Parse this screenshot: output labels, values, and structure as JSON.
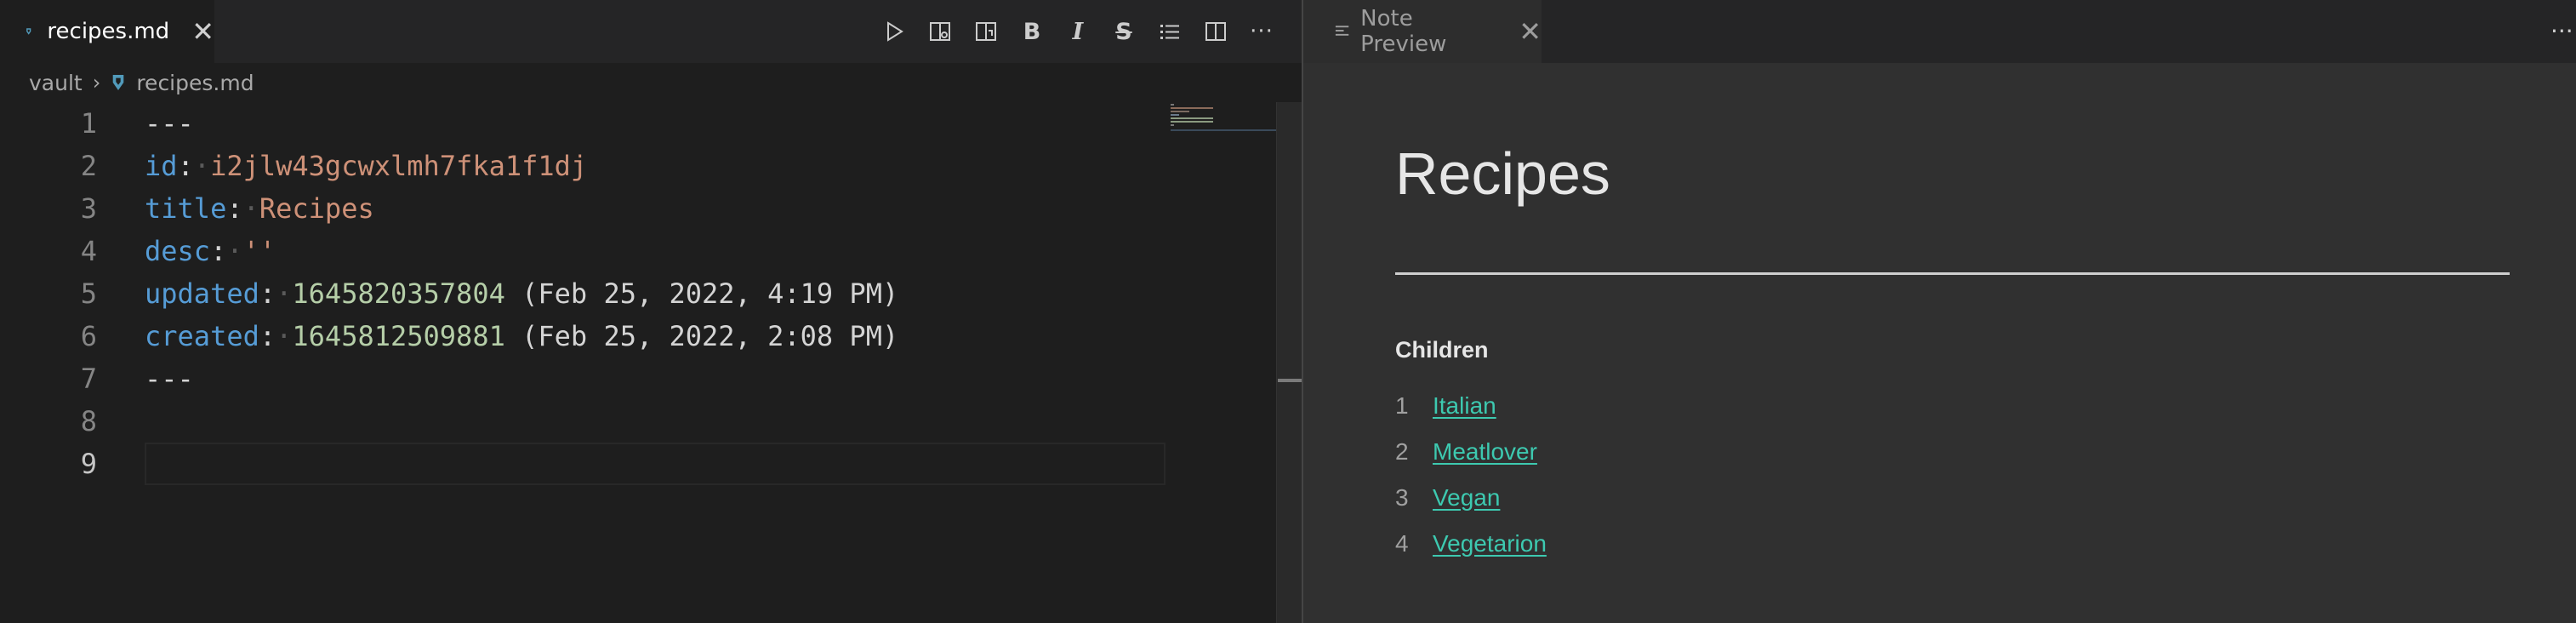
{
  "editor": {
    "tab": {
      "label": "recipes.md",
      "close": "✕"
    },
    "toolbar": {
      "buttons": [
        "run-icon",
        "open-preview-icon",
        "preview-side-icon",
        "bold-icon",
        "italic-icon",
        "strikethrough-icon",
        "list-icon",
        "split-editor-icon",
        "more-actions-icon"
      ],
      "bold_glyph": "B",
      "italic_glyph": "I",
      "strike_glyph": "S",
      "more_glyph": "···"
    },
    "breadcrumb": {
      "folder": "vault",
      "separator": "›",
      "file": "recipes.md"
    },
    "lines": [
      {
        "num": "1",
        "tokens": [
          {
            "t": "---",
            "c": "p"
          }
        ]
      },
      {
        "num": "2",
        "tokens": [
          {
            "t": "id",
            "c": "k"
          },
          {
            "t": ":",
            "c": "p"
          },
          {
            "t": "·",
            "c": "dot"
          },
          {
            "t": "i2jlw43gcwxlmh7fka1f1dj",
            "c": "s"
          }
        ]
      },
      {
        "num": "3",
        "tokens": [
          {
            "t": "title",
            "c": "k"
          },
          {
            "t": ":",
            "c": "p"
          },
          {
            "t": "·",
            "c": "dot"
          },
          {
            "t": "Recipes",
            "c": "s"
          }
        ]
      },
      {
        "num": "4",
        "tokens": [
          {
            "t": "desc",
            "c": "k"
          },
          {
            "t": ":",
            "c": "p"
          },
          {
            "t": "·",
            "c": "dot"
          },
          {
            "t": "''",
            "c": "s"
          }
        ]
      },
      {
        "num": "5",
        "tokens": [
          {
            "t": "updated",
            "c": "k"
          },
          {
            "t": ":",
            "c": "p"
          },
          {
            "t": "·",
            "c": "dot"
          },
          {
            "t": "1645820357804",
            "c": "n"
          },
          {
            "t": " (Feb 25, 2022, 4:19 PM)",
            "c": "p"
          }
        ]
      },
      {
        "num": "6",
        "tokens": [
          {
            "t": "created",
            "c": "k"
          },
          {
            "t": ":",
            "c": "p"
          },
          {
            "t": "·",
            "c": "dot"
          },
          {
            "t": "1645812509881",
            "c": "n"
          },
          {
            "t": " (Feb 25, 2022, 2:08 PM)",
            "c": "p"
          }
        ]
      },
      {
        "num": "7",
        "tokens": [
          {
            "t": "---",
            "c": "p"
          }
        ]
      },
      {
        "num": "8",
        "tokens": []
      },
      {
        "num": "9",
        "tokens": [],
        "active": true
      }
    ]
  },
  "preview": {
    "tab": {
      "label": "Note Preview",
      "close": "✕"
    },
    "more_glyph": "···",
    "title": "Recipes",
    "children_heading": "Children",
    "children": [
      {
        "num": "1",
        "label": "Italian"
      },
      {
        "num": "2",
        "label": "Meatlover"
      },
      {
        "num": "3",
        "label": "Vegan"
      },
      {
        "num": "4",
        "label": "Vegetarion"
      }
    ]
  },
  "colors": {
    "link": "#3dc9b0",
    "key": "#569cd6",
    "string": "#ce9178",
    "number": "#b5cea8",
    "md_icon": "#519aba"
  }
}
